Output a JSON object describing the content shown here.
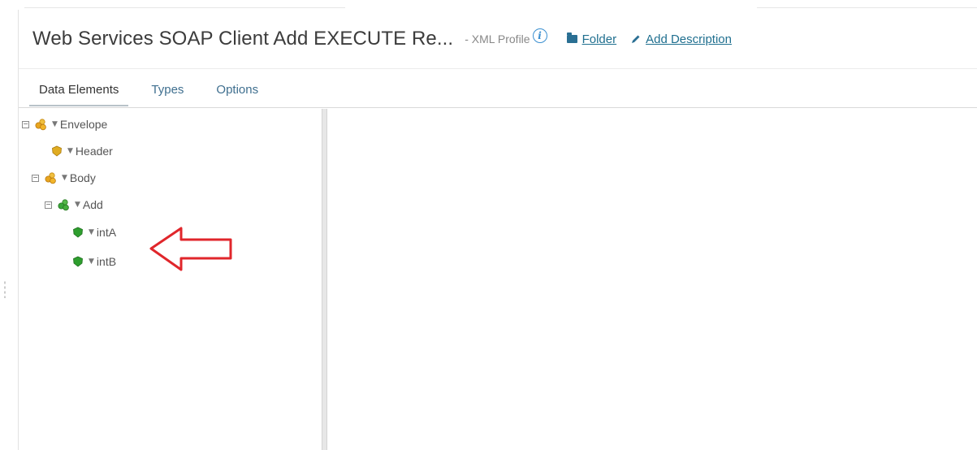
{
  "profile": {
    "title": "Web Services SOAP Client Add EXECUTE Re...",
    "subtitle": "- XML Profile",
    "info_icon": "info-icon",
    "folder_label": "Folder",
    "description_label": "Add Description"
  },
  "tabs": [
    {
      "label": "Data Elements",
      "active": true
    },
    {
      "label": "Types",
      "active": false
    },
    {
      "label": "Options",
      "active": false
    }
  ],
  "tree": [
    {
      "label": "Envelope",
      "icon": "multi-element-icon",
      "color": "#e2a21b",
      "expandable": true
    },
    {
      "label": "Header",
      "icon": "element-icon",
      "color": "#d9a31c",
      "expandable": false
    },
    {
      "label": "Body",
      "icon": "multi-element-icon",
      "color": "#e2a21b",
      "expandable": true
    },
    {
      "label": "Add",
      "icon": "multi-element-icon",
      "color": "#3aa63a",
      "expandable": true
    },
    {
      "label": "intA",
      "icon": "element-icon",
      "color": "#2e9e2e",
      "expandable": false
    },
    {
      "label": "intB",
      "icon": "element-icon",
      "color": "#2e9e2e",
      "expandable": false
    }
  ],
  "annotation": {
    "color": "#e0262b",
    "icon": "arrow-left-icon"
  }
}
